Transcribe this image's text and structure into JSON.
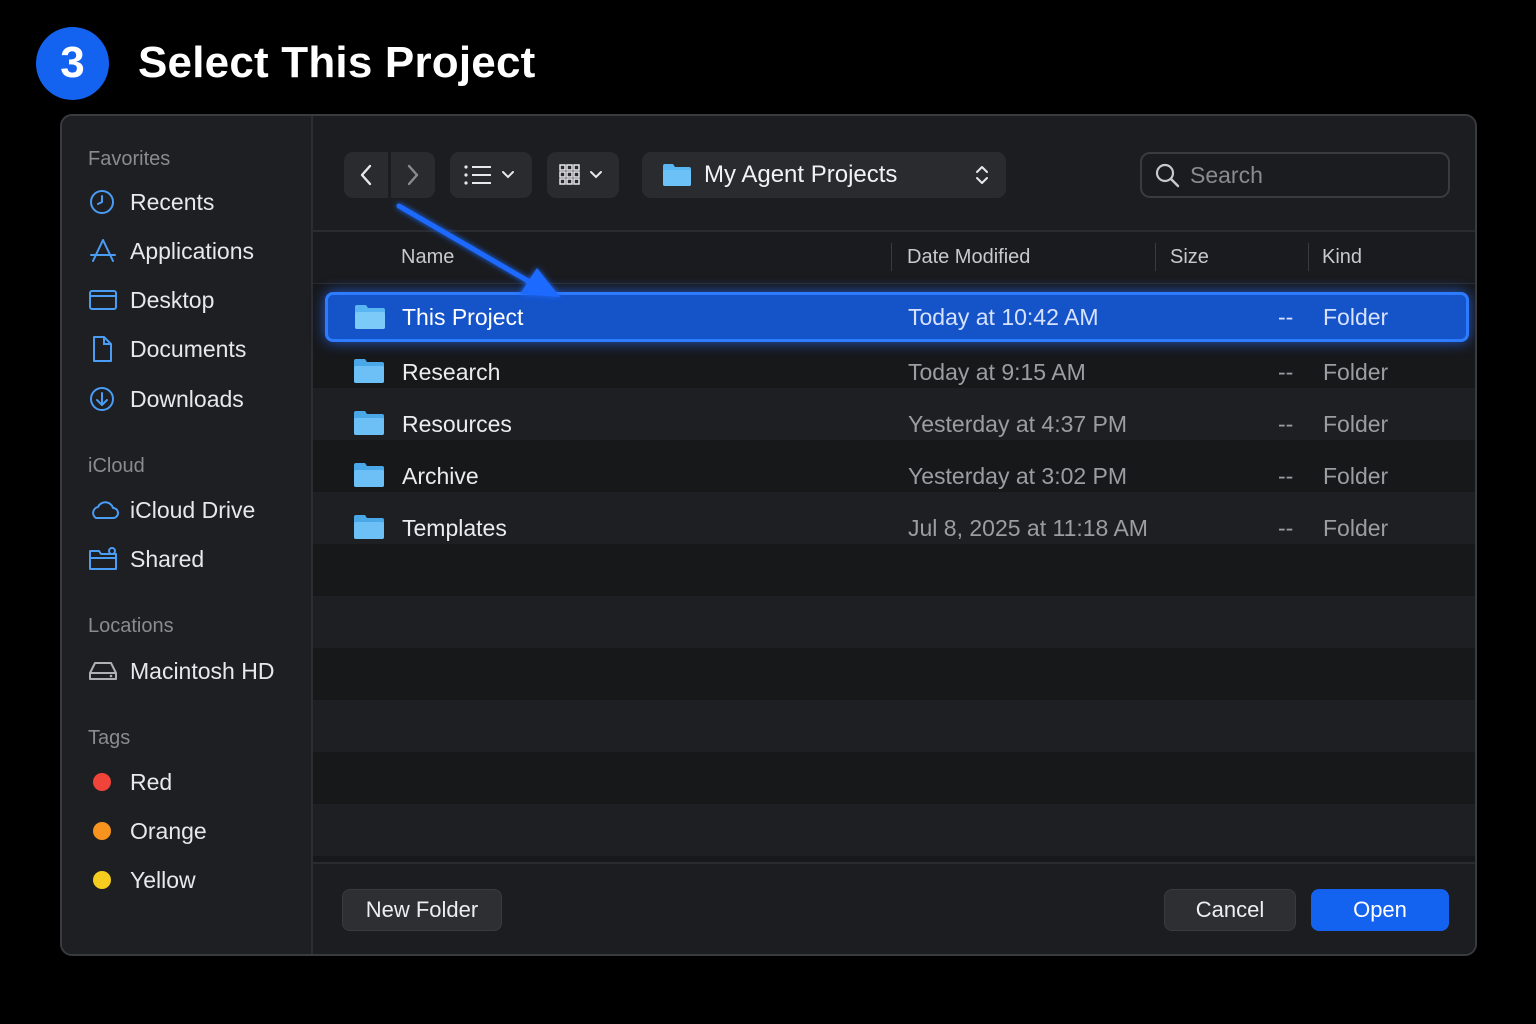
{
  "step": {
    "number": "3",
    "title": "Select This Project"
  },
  "sidebar": {
    "favorites_label": "Favorites",
    "favorites": [
      {
        "label": "Recents",
        "icon": "clock-icon"
      },
      {
        "label": "Applications",
        "icon": "applications-icon"
      },
      {
        "label": "Desktop",
        "icon": "desktop-icon"
      },
      {
        "label": "Documents",
        "icon": "document-icon"
      },
      {
        "label": "Downloads",
        "icon": "download-icon"
      }
    ],
    "icloud_label": "iCloud",
    "icloud": [
      {
        "label": "iCloud Drive",
        "icon": "cloud-icon"
      },
      {
        "label": "Shared",
        "icon": "shared-folder-icon"
      }
    ],
    "locations_label": "Locations",
    "locations": [
      {
        "label": "Macintosh HD",
        "icon": "hard-drive-icon"
      }
    ],
    "tags_label": "Tags",
    "tags": [
      {
        "label": "Red",
        "color": "#f0443a"
      },
      {
        "label": "Orange",
        "color": "#f7931e"
      },
      {
        "label": "Yellow",
        "color": "#f5cc1f"
      }
    ]
  },
  "toolbar": {
    "current_folder": "My Agent Projects",
    "search_placeholder": "Search"
  },
  "columns": {
    "name": "Name",
    "date": "Date Modified",
    "size": "Size",
    "kind": "Kind"
  },
  "files": [
    {
      "name": "This Project",
      "date": "Today at 10:42 AM",
      "size": "--",
      "kind": "Folder",
      "selected": true
    },
    {
      "name": "Research",
      "date": "Today at 9:15 AM",
      "size": "--",
      "kind": "Folder"
    },
    {
      "name": "Resources",
      "date": "Yesterday at 4:37 PM",
      "size": "--",
      "kind": "Folder"
    },
    {
      "name": "Archive",
      "date": "Yesterday at 3:02 PM",
      "size": "--",
      "kind": "Folder"
    },
    {
      "name": "Templates",
      "date": "Jul 8, 2025 at 11:18 AM",
      "size": "--",
      "kind": "Folder"
    }
  ],
  "footer": {
    "new_folder": "New Folder",
    "cancel": "Cancel",
    "open": "Open"
  },
  "colors": {
    "accent": "#1463f0",
    "selection": "#1553c9",
    "folder": "#4fb0f0"
  }
}
